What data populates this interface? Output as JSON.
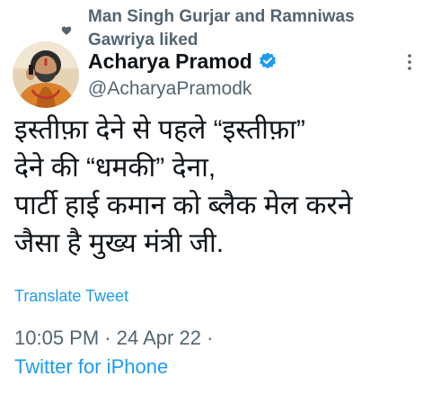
{
  "social_context": {
    "text": "Man Singh Gurjar and Ramniwas Gawriya liked",
    "icon": "heart-icon"
  },
  "author": {
    "display_name": "Acharya Pramod",
    "handle": "@AcharyaPramodk",
    "verified": true,
    "avatar": "avatar"
  },
  "tweet": {
    "lines": [
      "इस्तीफ़ा देने से पहले “इस्तीफ़ा”",
      "देने की “धमकी” देना,",
      "पार्टी हाई कमान को ब्लैक मेल करने",
      "जैसा है मुख्य मंत्री जी."
    ],
    "translate_label": "Translate Tweet",
    "time": "10:05 PM",
    "separator": "·",
    "date": "24 Apr 22",
    "source": "Twitter for iPhone"
  },
  "colors": {
    "primary_text": "#0f1419",
    "secondary_text": "#536471",
    "link": "#1d9bf0",
    "verified_badge": "#1d9bf0"
  }
}
